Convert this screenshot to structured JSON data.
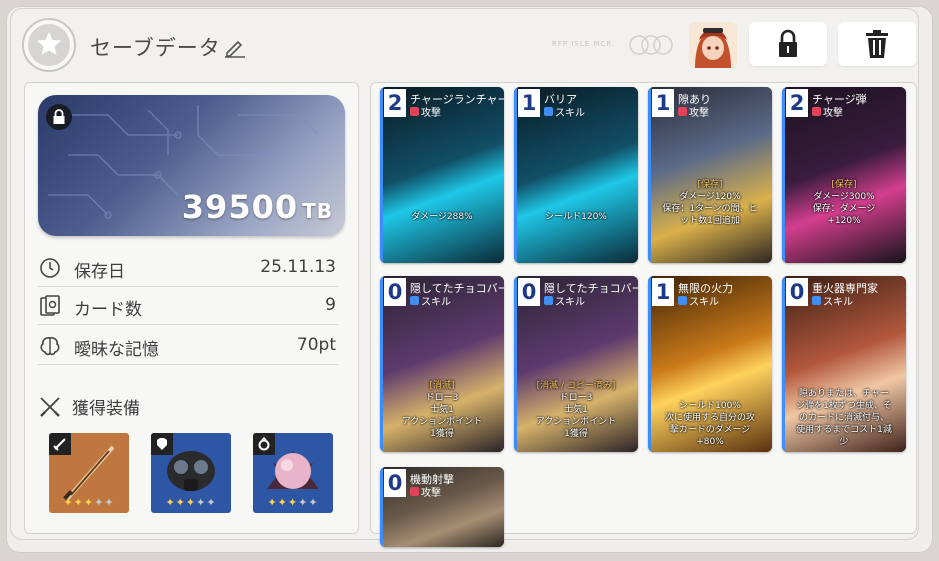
{
  "header": {
    "title": "セーブデータ",
    "deco_text": "RFP ISLE MCR.",
    "edit_icon": "pencil-icon",
    "lock_icon": "lock-icon",
    "delete_icon": "trash-icon"
  },
  "wallet": {
    "amount": "39500",
    "unit": "TB",
    "lock_icon": "lock-icon"
  },
  "stats": [
    {
      "icon": "clock-icon",
      "label": "保存日",
      "value": "25.11.13"
    },
    {
      "icon": "card-deck-icon",
      "label": "カード数",
      "value": "9"
    },
    {
      "icon": "brain-icon",
      "label": "曖昧な記憶",
      "value": "70pt"
    }
  ],
  "equipment": {
    "title": "獲得装備",
    "title_icon": "crossed-swords-icon",
    "items": [
      {
        "slot_icon": "sword-icon",
        "name": "sword",
        "stars": 3,
        "max_stars": 5,
        "bg": "#c0763f"
      },
      {
        "slot_icon": "armor-icon",
        "name": "gas-mask",
        "stars": 3,
        "max_stars": 5,
        "bg": "#2d57a5"
      },
      {
        "slot_icon": "ring-icon",
        "name": "orb",
        "stars": 3,
        "max_stars": 5,
        "bg": "#2d57a5"
      }
    ]
  },
  "cards": [
    {
      "cost": "2",
      "name": "チャージランチャー",
      "type": "攻撃",
      "type_color": "#e0425a",
      "desc": [
        "ダメージ288%"
      ],
      "theme": "cyan"
    },
    {
      "cost": "1",
      "name": "バリア",
      "type": "スキル",
      "type_color": "#3f8ef0",
      "desc": [
        "シールド120%"
      ],
      "theme": "cyan"
    },
    {
      "cost": "1",
      "name": "隙あり",
      "type": "攻撃",
      "type_color": "#e0425a",
      "desc": [
        "[保存]",
        "ダメージ120%",
        "保存：1ターンの間、ヒ",
        "ット数1回追加"
      ],
      "theme": "gold"
    },
    {
      "cost": "2",
      "name": "チャージ弾",
      "type": "攻撃",
      "type_color": "#e0425a",
      "desc": [
        "[保存]",
        "ダメージ300%",
        "保存：ダメージ",
        "+120%"
      ],
      "theme": "magenta"
    },
    {
      "cost": "0",
      "name": "隠してたチョコバー",
      "type": "スキル",
      "type_color": "#3f8ef0",
      "desc": [
        "[消滅]",
        "ドロー3",
        "士気1",
        "アクションポイント",
        "1獲得"
      ],
      "theme": "choco"
    },
    {
      "cost": "0",
      "name": "隠してたチョコバー",
      "type": "スキル",
      "type_color": "#3f8ef0",
      "desc": [
        "[消滅 / コピー済み]",
        "ドロー3",
        "士気1",
        "アクションポイント",
        "1獲得"
      ],
      "theme": "choco"
    },
    {
      "cost": "1",
      "name": "無限の火力",
      "type": "スキル",
      "type_color": "#3f8ef0",
      "desc": [
        "シールド100%",
        "次に使用する自分の攻",
        "撃カードのダメージ",
        "+80%"
      ],
      "theme": "fire"
    },
    {
      "cost": "0",
      "name": "重火器専門家",
      "type": "スキル",
      "type_color": "#3f8ef0",
      "desc": [
        "隙ありまたは、チャー",
        "ジ弾を1枚ずつ生成、そ",
        "のカードに消滅付与、",
        "使用するまでコスト1減",
        "少"
      ],
      "theme": "warm"
    },
    {
      "cost": "0",
      "name": "機動射撃",
      "type": "攻撃",
      "type_color": "#e0425a",
      "desc": [],
      "theme": "soldier"
    }
  ]
}
